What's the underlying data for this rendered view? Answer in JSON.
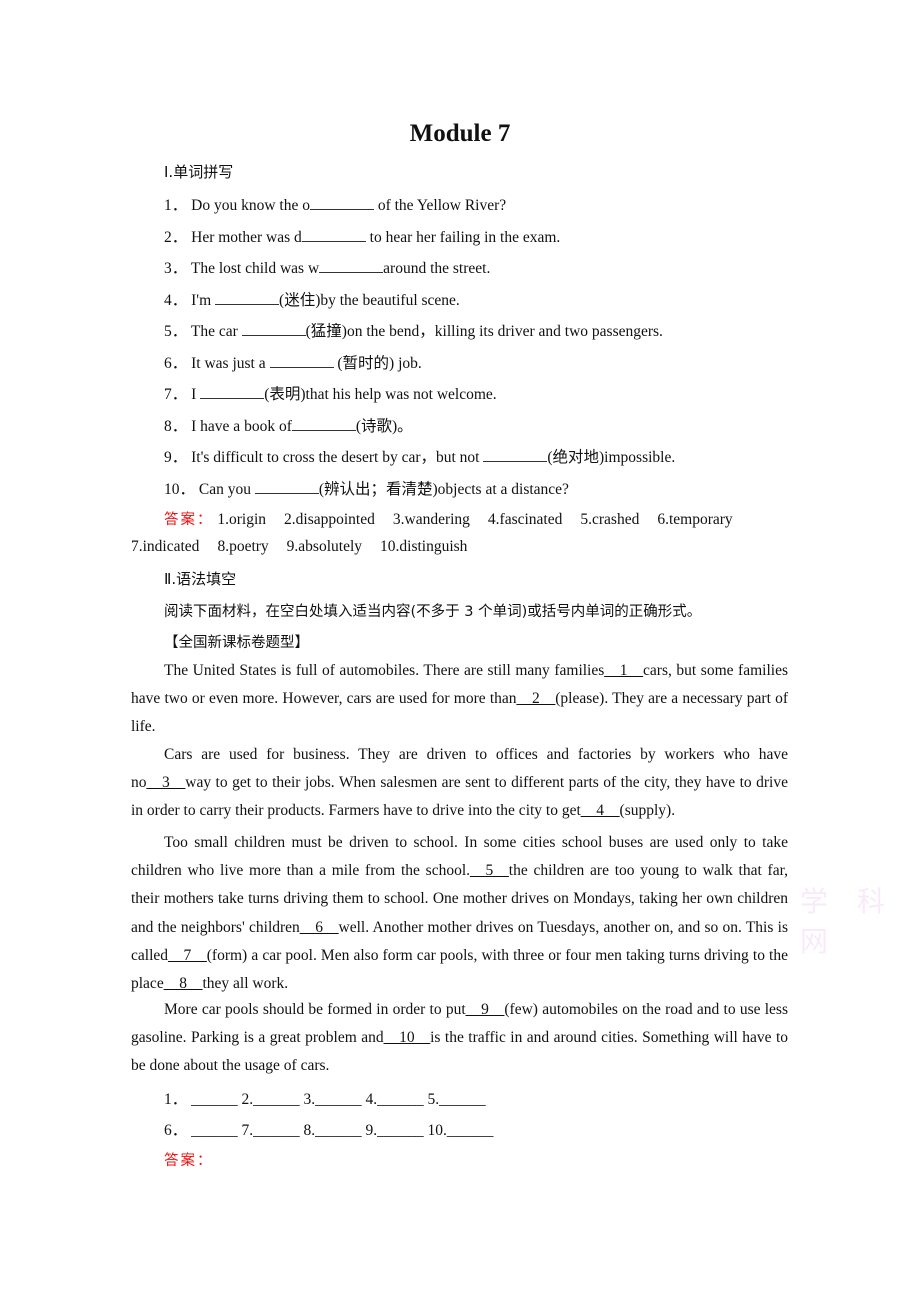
{
  "title": "Module 7",
  "section1": {
    "heading": "Ⅰ.单词拼写",
    "items": [
      {
        "num": "1．",
        "pre": "Do you know the o",
        "blank": true,
        "post": " of the Yellow River?"
      },
      {
        "num": "2．",
        "pre": "Her mother was d",
        "blank": true,
        "post": " to hear her failing in the exam."
      },
      {
        "num": "3．",
        "pre": "The lost child was w",
        "blank": true,
        "post": "around the street."
      },
      {
        "num": "4．",
        "pre": "I'm ",
        "blank": true,
        "post": "(迷住)by the beautiful scene."
      },
      {
        "num": "5．",
        "pre": "The car ",
        "blank": true,
        "post": "(猛撞)on the bend，killing its driver and two passengers."
      },
      {
        "num": "6．",
        "pre": "It was just a ",
        "blank": true,
        "post": " (暂时的) job."
      },
      {
        "num": "7．",
        "pre": "I ",
        "blank": true,
        "post": "(表明)that his help was not welcome."
      },
      {
        "num": "8．",
        "pre": "I have a book of",
        "blank": true,
        "post": "(诗歌)。"
      },
      {
        "num": "9．",
        "pre": "It's difficult to cross the desert by car，but not ",
        "blank": true,
        "post": "(绝对地)impossible."
      },
      {
        "num": "10．",
        "pre": "Can you ",
        "blank": true,
        "post": "(辨认出；看清楚)objects at a distance?"
      }
    ],
    "answer_label": "答案：",
    "answers_line1": [
      "1.origin",
      "2.disappointed",
      "3.wandering",
      "4.fascinated",
      "5.crashed",
      "6.temporary"
    ],
    "answers_line2": [
      "7.indicated",
      "8.poetry",
      "9.absolutely",
      "10.distinguish"
    ]
  },
  "section2": {
    "heading": "Ⅱ.语法填空",
    "instruction": "阅读下面材料，在空白处填入适当内容(不多于 3 个单词)或括号内单词的正确形式。",
    "tag": "【全国新课标卷题型】",
    "paragraphs": [
      [
        {
          "t": "The United States is full of automobiles. There are still many families"
        },
        {
          "n": "__1__"
        },
        {
          "t": "cars, but some families have two or even more. However, cars are used for more than"
        },
        {
          "n": "__2__"
        },
        {
          "t": "(please). They are a necessary part of life."
        }
      ],
      [
        {
          "t": "Cars are used for business. They are driven to offices and factories by workers who have no"
        },
        {
          "n": "__3__"
        },
        {
          "t": "way to get to their jobs. When salesmen are sent to different parts of the city, they have to drive in order to carry their products. Farmers have to drive into the city to get"
        },
        {
          "n": "__4__"
        },
        {
          "t": "(supply)."
        }
      ],
      [
        {
          "t": "Too small children must be driven to school. In some cities school buses are used only to take children who live more than a mile from the school."
        },
        {
          "n": "__5__"
        },
        {
          "t": "the children are too young to walk that far, their mothers take turns driving them to school. One mother drives on Mondays, taking her own children and the neighbors' children"
        },
        {
          "n": "__6__"
        },
        {
          "t": "well. Another mother drives on Tuesdays, another on, and so on. This is called"
        },
        {
          "n": "__7__"
        },
        {
          "t": "(form) a car pool. Men also form car pools, with three or four men taking turns driving to the place"
        },
        {
          "n": "__8__"
        },
        {
          "t": "they all work."
        }
      ],
      [
        {
          "t": "More car pools should be formed in order to put"
        },
        {
          "n": "__9__"
        },
        {
          "t": "(few) automobiles on the road and to use less gasoline. Parking is a great problem and"
        },
        {
          "n": "__10__"
        },
        {
          "t": "is the traffic in and around cities. Something will have to be done about the usage of cars."
        }
      ]
    ],
    "answer_row1": "1．  ______ 2.______ 3.______ 4.______ 5.______",
    "answer_row2": "6．  ______ 7.______ 8.______ 9.______ 10.______",
    "answer_label": "答案："
  },
  "watermark": "学 科 网",
  "colors": {
    "answer_red": "#ee1111"
  }
}
